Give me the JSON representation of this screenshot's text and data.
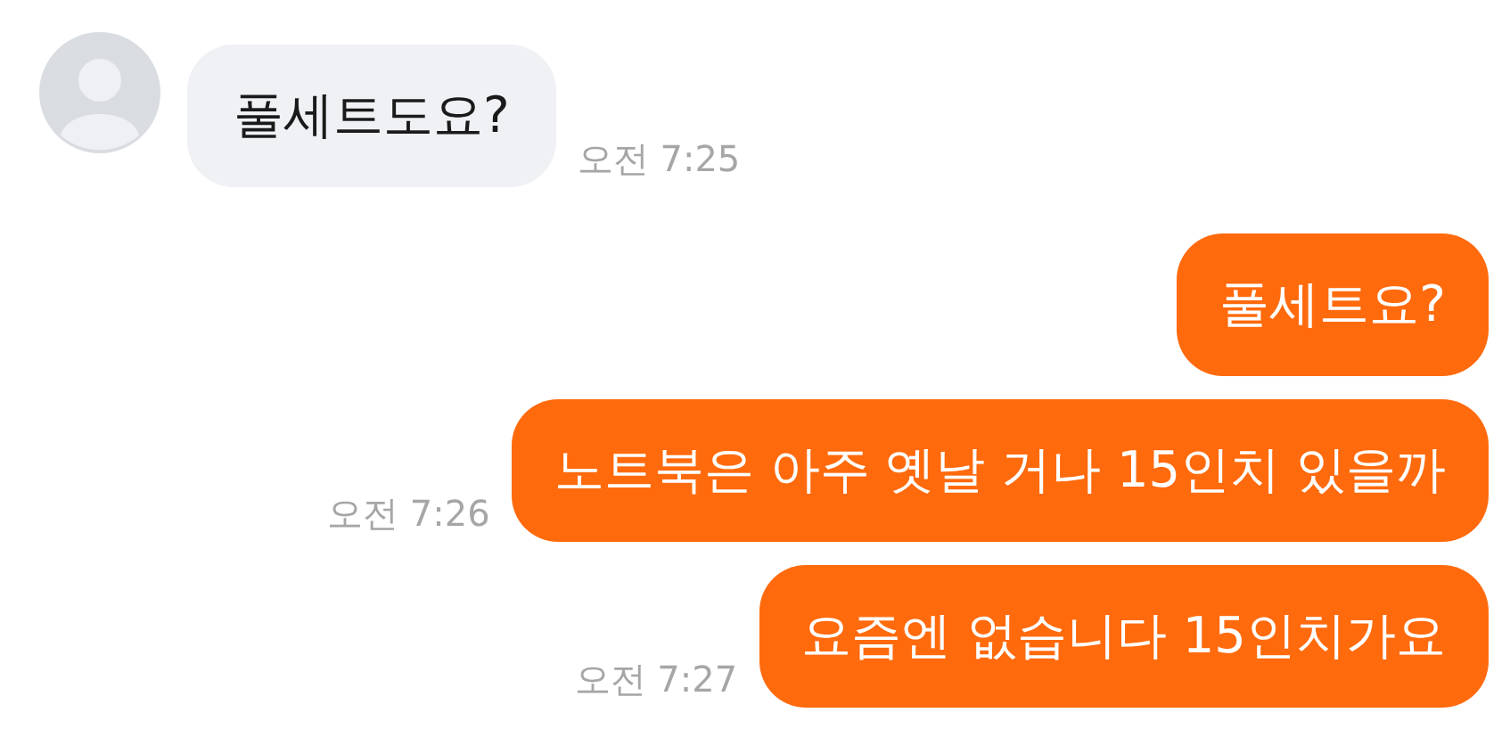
{
  "messages": [
    {
      "kind": "received",
      "text": "풀세트도요?",
      "time": "오전 7:25"
    },
    {
      "kind": "sent",
      "text": "풀세트요?"
    },
    {
      "kind": "sent",
      "text": "노트북은 아주 옛날 거나 15인치 있을까",
      "time": "오전 7:26"
    },
    {
      "kind": "sent",
      "text": "요즘엔 없습니다 15인치가요",
      "time": "오전 7:27"
    }
  ]
}
